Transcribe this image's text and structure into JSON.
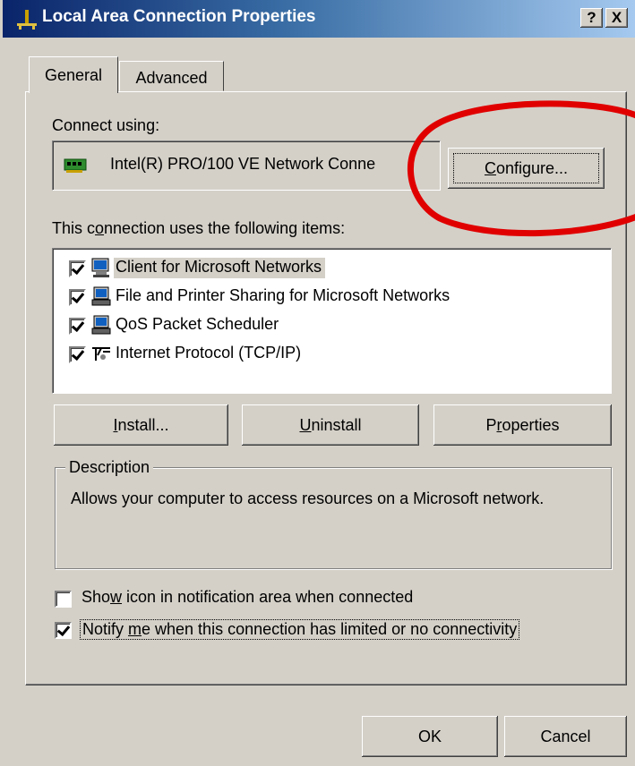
{
  "window": {
    "title": "Local Area Connection Properties",
    "help_label": "?",
    "close_label": "X"
  },
  "tabs": [
    {
      "label": "General",
      "selected": true
    },
    {
      "label": "Advanced",
      "selected": false
    }
  ],
  "connect_using": {
    "label": "Connect using:",
    "adapter": "Intel(R) PRO/100 VE Network Conne",
    "configure_button": {
      "before": "",
      "mnemonic": "C",
      "after": "onfigure..."
    }
  },
  "items_section": {
    "label_before": "This c",
    "label_mnemonic": "o",
    "label_after": "nnection uses the following items:",
    "items": [
      {
        "label": "Client for Microsoft Networks",
        "checked": true,
        "icon": "client-icon"
      },
      {
        "label": "File and Printer Sharing for Microsoft Networks",
        "checked": true,
        "icon": "service-icon"
      },
      {
        "label": "QoS Packet Scheduler",
        "checked": true,
        "icon": "service-icon"
      },
      {
        "label": "Internet Protocol (TCP/IP)",
        "checked": true,
        "icon": "protocol-icon"
      }
    ]
  },
  "buttons": {
    "install": {
      "mnemonic": "I",
      "rest": "nstall..."
    },
    "uninstall": {
      "mnemonic": "U",
      "rest": "ninstall"
    },
    "properties": {
      "before": "P",
      "mnemonic": "r",
      "after": "operties"
    },
    "ok": "OK",
    "cancel": "Cancel"
  },
  "description": {
    "legend": "Description",
    "text": "Allows your computer to access resources on a Microsoft network."
  },
  "options": {
    "show_icon": {
      "before": "Sho",
      "mnemonic": "w",
      "after": " icon in notification area when connected",
      "checked": false
    },
    "notify": {
      "before": "Notify ",
      "mnemonic": "m",
      "after": "e when this connection has limited or no connectivity",
      "checked": true
    }
  },
  "colors": {
    "face": "#d4d0c8",
    "title_start": "#0a246a",
    "title_end": "#a6caf0",
    "annotation": "#e00000"
  }
}
